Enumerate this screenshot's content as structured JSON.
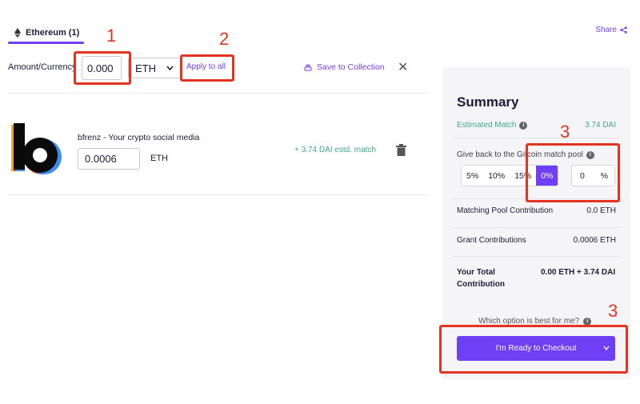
{
  "tabs": [
    {
      "label": "Ethereum (1)"
    }
  ],
  "header": {
    "share_label": "Share"
  },
  "amount_row": {
    "label": "Amount/Currency",
    "amount_value": "0.000",
    "currency": "ETH",
    "apply_label": "Apply to all",
    "save_label": "Save to Collection",
    "close_glyph": "✕"
  },
  "grant": {
    "title": "bfrenz - Your crypto social media",
    "amount_value": "0.0006",
    "currency": "ETH",
    "estd_match": "+ 3.74 DAI estd. match"
  },
  "summary": {
    "title": "Summary",
    "estimated_match_label": "Estimated Match",
    "estimated_match_value": "3.74 DAI",
    "giveback_label": "Give back to the Gitcoin match pool",
    "percent_options": [
      "5%",
      "10%",
      "15%",
      "0%"
    ],
    "active_option": "0%",
    "custom_value": "0",
    "custom_unit": "%",
    "matching_label": "Matching Pool Contribution",
    "matching_value": "0.0 ETH",
    "grant_contrib_label": "Grant Contributions",
    "grant_contrib_value": "0.0006 ETH",
    "total_label": "Your Total Contribution",
    "total_value": "0.00 ETH + 3.74 DAI",
    "which_option": "Which option is best for me?",
    "checkout_label": "I'm Ready to Checkout"
  },
  "annotations": [
    "1",
    "2",
    "3",
    "3"
  ],
  "colors": {
    "accent": "#6f3ff5",
    "match_green": "#3fa88a",
    "annotation_red": "#e53322"
  },
  "icons": [
    "ethereum-icon",
    "share-icon",
    "chevron-down-icon",
    "collection-icon",
    "close-icon",
    "trash-icon",
    "info-icon"
  ]
}
